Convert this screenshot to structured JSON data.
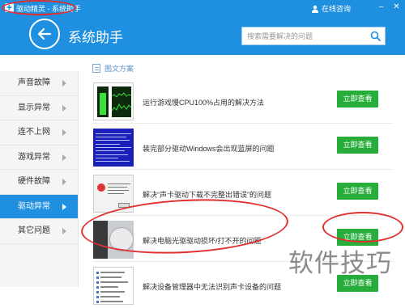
{
  "window": {
    "title": "驱动精灵 - 系统助手",
    "online_service": "在线咨询",
    "controls": [
      "minimize",
      "close"
    ]
  },
  "header": {
    "back_icon": "arrow-left-icon",
    "page_title": "系统助手",
    "search_placeholder": "搜索需要解决的问题",
    "search_icon": "search-icon"
  },
  "sidebar": {
    "items": [
      {
        "label": "声音故障",
        "active": false
      },
      {
        "label": "显示异常",
        "active": false
      },
      {
        "label": "连不上网",
        "active": false
      },
      {
        "label": "游戏异常",
        "active": false
      },
      {
        "label": "硬件故障",
        "active": false
      },
      {
        "label": "驱动异常",
        "active": true
      },
      {
        "label": "其它问题",
        "active": false
      }
    ]
  },
  "section": {
    "label": "图文方案",
    "icon": "document-icon"
  },
  "articles": [
    {
      "title": "运行游戏慢CPU100%占用的解决方法",
      "button": "立即查看"
    },
    {
      "title": "装完部分驱动Windows会出现蓝屏的问题",
      "button": "立即查看"
    },
    {
      "title": "解决“声卡驱动下载不完整出错误”的问题",
      "button": "立即查看"
    },
    {
      "title": "解决电脑光驱驱动损坏/打不开的问题",
      "button": "立即查看"
    },
    {
      "title": "解决设备管理器中无法识别声卡设备的问题",
      "button": "立即查看"
    }
  ],
  "watermark": "软件技巧",
  "colors": {
    "brand_blue": "#1f8fe0",
    "button_green": "#27ad3a",
    "annotation_red": "#e03030"
  }
}
